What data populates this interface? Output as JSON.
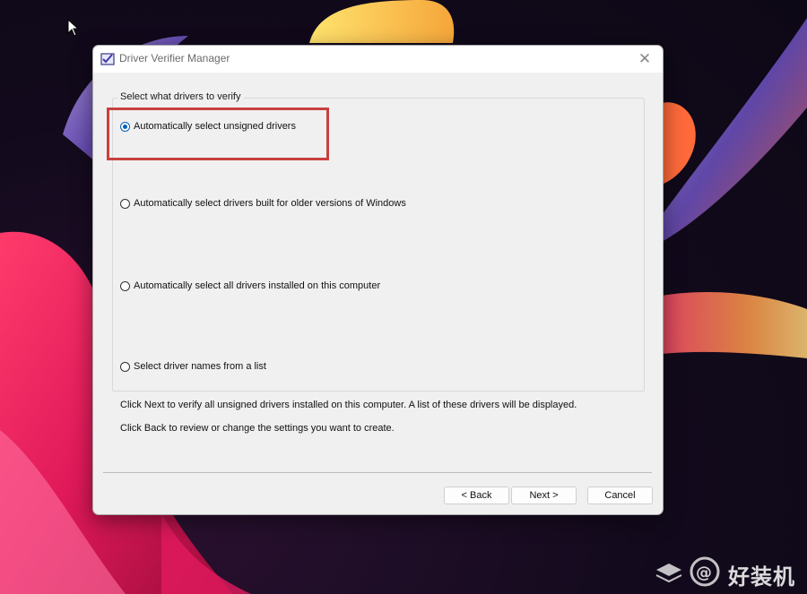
{
  "dialog": {
    "title": "Driver Verifier Manager",
    "close_glyph": "✕"
  },
  "group": {
    "label": "Select what drivers to verify",
    "options": [
      {
        "label": "Automatically select unsigned drivers",
        "selected": true
      },
      {
        "label": "Automatically select drivers built for older versions of Windows",
        "selected": false
      },
      {
        "label": "Automatically select all drivers installed on this computer",
        "selected": false
      },
      {
        "label": "Select driver names from a list",
        "selected": false
      }
    ]
  },
  "description": {
    "line1": "Click Next to verify all unsigned drivers installed on this computer. A list of these drivers will be displayed.",
    "line2": "Click Back to review or change the settings you want to create."
  },
  "buttons": {
    "back": "< Back",
    "next": "Next >",
    "cancel": "Cancel"
  },
  "watermark": {
    "text": "好装机"
  },
  "colors": {
    "highlight": "#c8403d",
    "accent": "#005fb8"
  }
}
